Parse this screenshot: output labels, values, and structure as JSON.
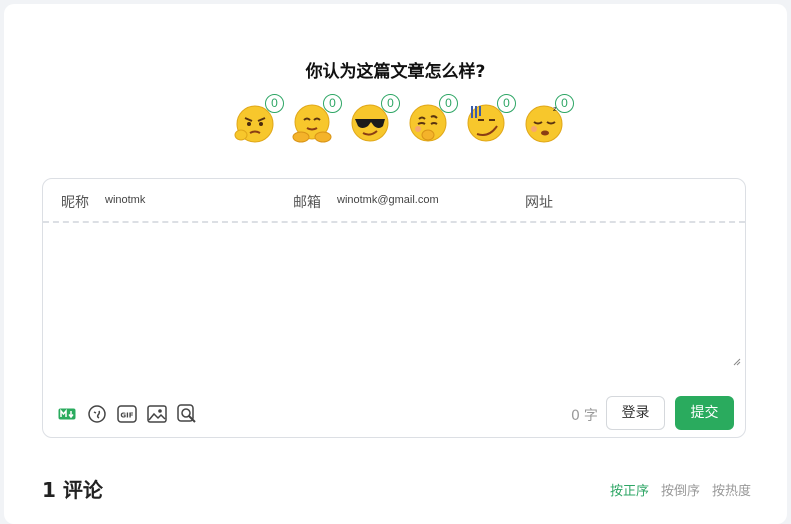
{
  "reactions": {
    "title": "你认为这篇文章怎么样?",
    "items": [
      {
        "icon": "angry-face-icon",
        "count": "0"
      },
      {
        "icon": "hugging-face-icon",
        "count": "0"
      },
      {
        "icon": "sunglasses-face-icon",
        "count": "0"
      },
      {
        "icon": "thinking-face-icon",
        "count": "0"
      },
      {
        "icon": "awkward-face-icon",
        "count": "0"
      },
      {
        "icon": "sleepy-face-icon",
        "count": "0"
      }
    ]
  },
  "form": {
    "nickname_label": "昵称",
    "nickname_value": "winotmk",
    "email_label": "邮箱",
    "email_value": "winotmk@gmail.com",
    "url_label": "网址",
    "url_value": "",
    "textarea_value": ""
  },
  "toolbar": {
    "icons": [
      "markdown-icon",
      "emoji-icon",
      "gif-icon",
      "image-icon",
      "preview-icon"
    ],
    "word_count": "0",
    "word_unit": "字",
    "login_label": "登录",
    "submit_label": "提交"
  },
  "comments": {
    "heading": "1 评论",
    "sort": [
      {
        "label": "按正序",
        "active": true
      },
      {
        "label": "按倒序",
        "active": false
      },
      {
        "label": "按热度",
        "active": false
      }
    ]
  },
  "colors": {
    "accent": "#2aab5e",
    "count_green": "#2ea665"
  }
}
